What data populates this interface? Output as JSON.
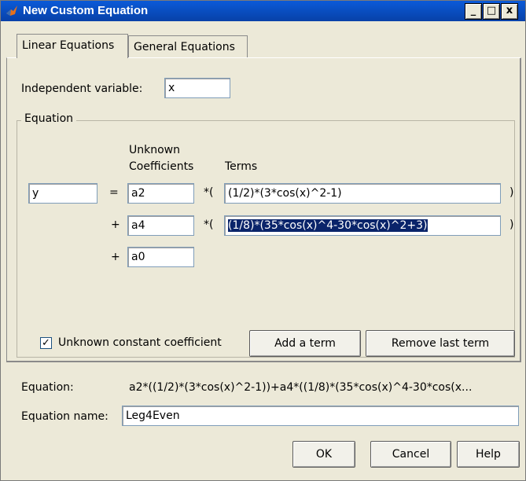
{
  "window": {
    "title": "New Custom Equation",
    "minimize_label": "_",
    "maximize_label": "□",
    "close_label": "x"
  },
  "tabs": [
    {
      "label": "Linear Equations",
      "active": true
    },
    {
      "label": "General Equations",
      "active": false
    }
  ],
  "independent_variable": {
    "label": "Independent variable:",
    "value": "x"
  },
  "equation_group": {
    "title": "Equation",
    "coef_header_line1": "Unknown",
    "coef_header_line2": "Coefficients",
    "terms_header": "Terms",
    "lhs_value": "y",
    "equals": "=",
    "rows": [
      {
        "op": "",
        "coef": "a2",
        "mult": "*(",
        "term": "(1/2)*(3*cos(x)^2-1)",
        "close": ")",
        "selected": false
      },
      {
        "op": "+",
        "coef": "a4",
        "mult": "*(",
        "term": "(1/8)*(35*cos(x)^4-30*cos(x)^2+3)",
        "close": ")",
        "selected": true
      }
    ],
    "constant_row": {
      "op": "+",
      "coef": "a0"
    },
    "checkbox": {
      "label": "Unknown constant coefficient",
      "checked": true,
      "mark": "✓"
    },
    "add_term_label": "Add a term",
    "remove_term_label": "Remove last term"
  },
  "equation_line": {
    "label": "Equation:",
    "value": "a2*((1/2)*(3*cos(x)^2-1))+a4*((1/8)*(35*cos(x)^4-30*cos(x..."
  },
  "equation_name": {
    "label": "Equation name:",
    "value": "Leg4Even"
  },
  "buttons": {
    "ok": "OK",
    "cancel": "Cancel",
    "help": "Help"
  },
  "colors": {
    "titlebar": "#0a5ad8",
    "dialog_bg": "#ece9d8",
    "selection": "#0a246a"
  }
}
